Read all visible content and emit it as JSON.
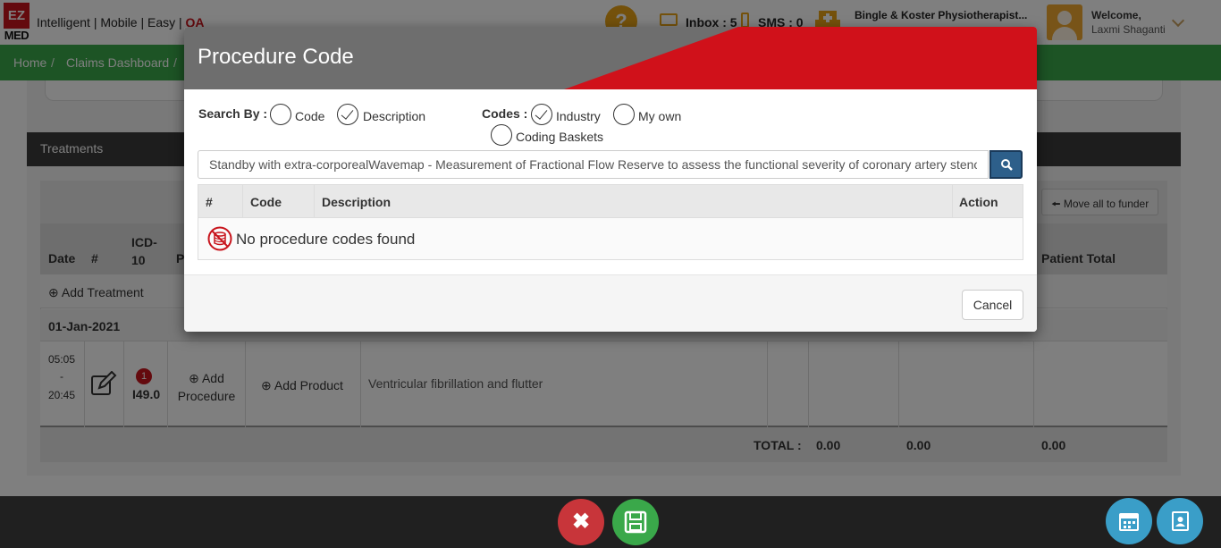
{
  "header": {
    "logo_top": "EZ",
    "logo_bottom": "MED",
    "tagline": "Intelligent | Mobile | Easy | ",
    "tagline_highlight": "QA",
    "help_glyph": "?",
    "inbox": "Inbox : 5",
    "sms": "SMS : 0",
    "practice": "Bingle & Koster Physiotherapist...",
    "welcome": "Welcome,",
    "user": "Laxmi Shaganti"
  },
  "breadcrumb": {
    "items": [
      "Home",
      "Claims Dashboard"
    ],
    "separator": "/"
  },
  "treatments": {
    "title": "Treatments",
    "move_all": "Move all to funder",
    "columns": {
      "date": "Date",
      "num": "#",
      "icd": "ICD-10",
      "p": "P",
      "patient_total": "Patient Total"
    },
    "add_treatment": "Add Treatment",
    "date_value": "01-Jan-2021",
    "row": {
      "time_start": "05:05",
      "time_dash": "-",
      "time_end": "20:45",
      "badge": "1",
      "icd_code": "I49.0",
      "add_procedure": "Add Procedure",
      "add_product": "Add Product",
      "description": "Ventricular fibrillation and flutter"
    },
    "total_label": "TOTAL :",
    "totals": [
      "0.00",
      "0.00",
      "0.00"
    ]
  },
  "modal": {
    "title": "Procedure Code",
    "search_by_label": "Search By :",
    "search_by_options": [
      {
        "label": "Code",
        "checked": false
      },
      {
        "label": "Description",
        "checked": true
      }
    ],
    "codes_label": "Codes :",
    "codes_options": [
      {
        "label": "Industry",
        "checked": true
      },
      {
        "label": "My own",
        "checked": false
      },
      {
        "label": "Coding Baskets",
        "checked": false
      }
    ],
    "search_value": "Standby with extra-corporealWavemap - Measurement of Fractional Flow Reserve to assess the functional severity of coronary artery stenosis",
    "results_columns": [
      "#",
      "Code",
      "Description",
      "Action"
    ],
    "empty_message": "No procedure codes found",
    "cancel": "Cancel"
  },
  "colors": {
    "brand_red": "#c8141c",
    "brand_green": "#3aa84a",
    "header_gray": "#6e6e6e",
    "search_blue": "#2d5f8a",
    "accent_orange": "#e8a317"
  }
}
